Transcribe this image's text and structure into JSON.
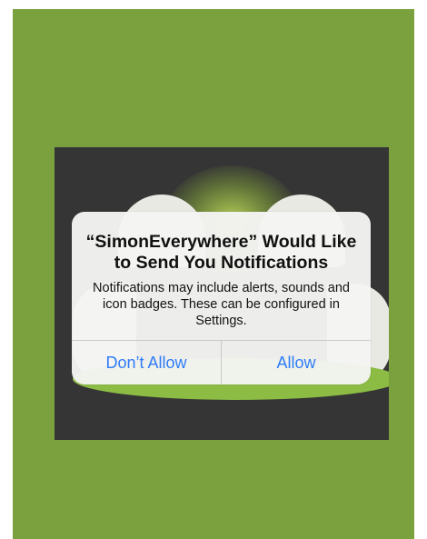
{
  "colors": {
    "frame_background": "#7aa13d",
    "game_background": "#353535",
    "alert_background": "#f4f4f2",
    "button_text": "#2f7cf6"
  },
  "alert": {
    "title": "“SimonEverywhere” Would Like to Send You Notifications",
    "message": "Notifications may include alerts, sounds and icon badges. These can be configured in Settings.",
    "buttons": {
      "deny_label": "Don’t Allow",
      "allow_label": "Allow"
    }
  }
}
